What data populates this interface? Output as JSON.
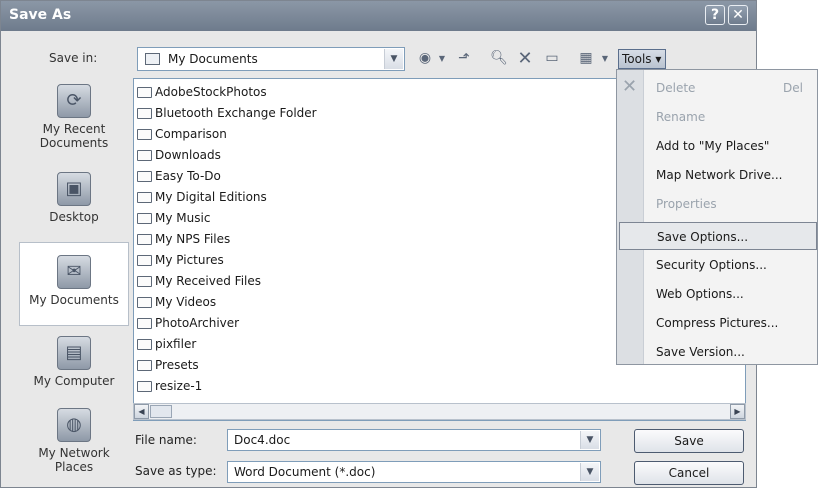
{
  "window": {
    "title": "Save As",
    "help_btn": "?",
    "close_btn": "✕"
  },
  "toolbar": {
    "save_in_label": "Save in:",
    "save_in_value": "My Documents",
    "tools_label": "Tools ▾"
  },
  "places": [
    {
      "label": "My Recent Documents",
      "icon": "recent-documents-icon"
    },
    {
      "label": "Desktop",
      "icon": "desktop-icon"
    },
    {
      "label": "My Documents",
      "icon": "my-documents-icon"
    },
    {
      "label": "My Computer",
      "icon": "my-computer-icon"
    },
    {
      "label": "My Network Places",
      "icon": "network-places-icon"
    }
  ],
  "files": [
    "AdobeStockPhotos",
    "Bluetooth Exchange Folder",
    "Comparison",
    "Downloads",
    "Easy To-Do",
    "My Digital Editions",
    "My Music",
    "My NPS Files",
    "My Pictures",
    "My Received Files",
    "My Videos",
    "PhotoArchiver",
    "pixfiler",
    "Presets",
    "resize-1"
  ],
  "file_name": {
    "label": "File name:",
    "value": "Doc4.doc"
  },
  "save_as_type": {
    "label": "Save as type:",
    "value": "Word Document (*.doc)"
  },
  "buttons": {
    "save": "Save",
    "cancel": "Cancel"
  },
  "tools_menu": [
    {
      "label": "Delete",
      "shortcut": "Del",
      "disabled": true
    },
    {
      "label": "Rename",
      "disabled": true
    },
    {
      "label": "Add to \"My Places\"",
      "disabled": false
    },
    {
      "label": "Map Network Drive...",
      "disabled": false
    },
    {
      "label": "Properties",
      "disabled": true
    },
    {
      "label": "Save Options...",
      "disabled": false,
      "highlighted": true
    },
    {
      "label": "Security Options...",
      "disabled": false
    },
    {
      "label": "Web Options...",
      "disabled": false
    },
    {
      "label": "Compress Pictures...",
      "disabled": false
    },
    {
      "label": "Save Version...",
      "disabled": false
    }
  ],
  "colors": {
    "title_bar": "#7a8797",
    "menu_bg": "#f3f3f3",
    "highlight": "#e6e8eb"
  }
}
